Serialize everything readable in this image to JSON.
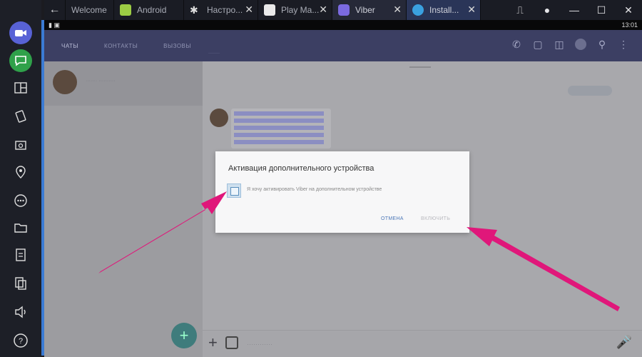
{
  "tabs": [
    {
      "label": "Welcome",
      "icon": "home-icon",
      "color": "#d7d7d7",
      "close": false
    },
    {
      "label": "Android",
      "icon": "android-icon",
      "color": "#9ccc44",
      "close": false
    },
    {
      "label": "Настро...",
      "icon": "settings-gear-icon",
      "color": "#dddddd",
      "close": true
    },
    {
      "label": "Play Ma...",
      "icon": "play-store-icon",
      "color": "#e9e9e9",
      "close": true
    },
    {
      "label": "Viber",
      "icon": "viber-icon",
      "color": "#7b6ae0",
      "close": true
    },
    {
      "label": "Install...",
      "icon": "globe-icon",
      "color": "#3aa0e0",
      "close": true
    }
  ],
  "window_controls": {
    "network": "⎍",
    "settings": "●",
    "minimize": "—",
    "maximize": "☐",
    "close": "✕"
  },
  "statusbar": {
    "time": "13:01"
  },
  "viber": {
    "tabs": [
      "ЧАТЫ",
      "КОНТАКТЫ",
      "ВЫЗОВЫ"
    ],
    "sub_label": "········",
    "chat": {
      "name": "·······  ··········"
    },
    "composer_placeholder": "············"
  },
  "dialog": {
    "title": "Активация дополнительного устройства",
    "checkbox_label": "Я хочу активировать Viber на дополнительном устройстве",
    "cancel": "ОТМЕНА",
    "ok": "ВКЛЮЧИТЬ"
  },
  "colors": {
    "annotation_arrow": "#e0177a",
    "viber_bar": "#3c3f63",
    "accent": "#3b7bd4"
  }
}
